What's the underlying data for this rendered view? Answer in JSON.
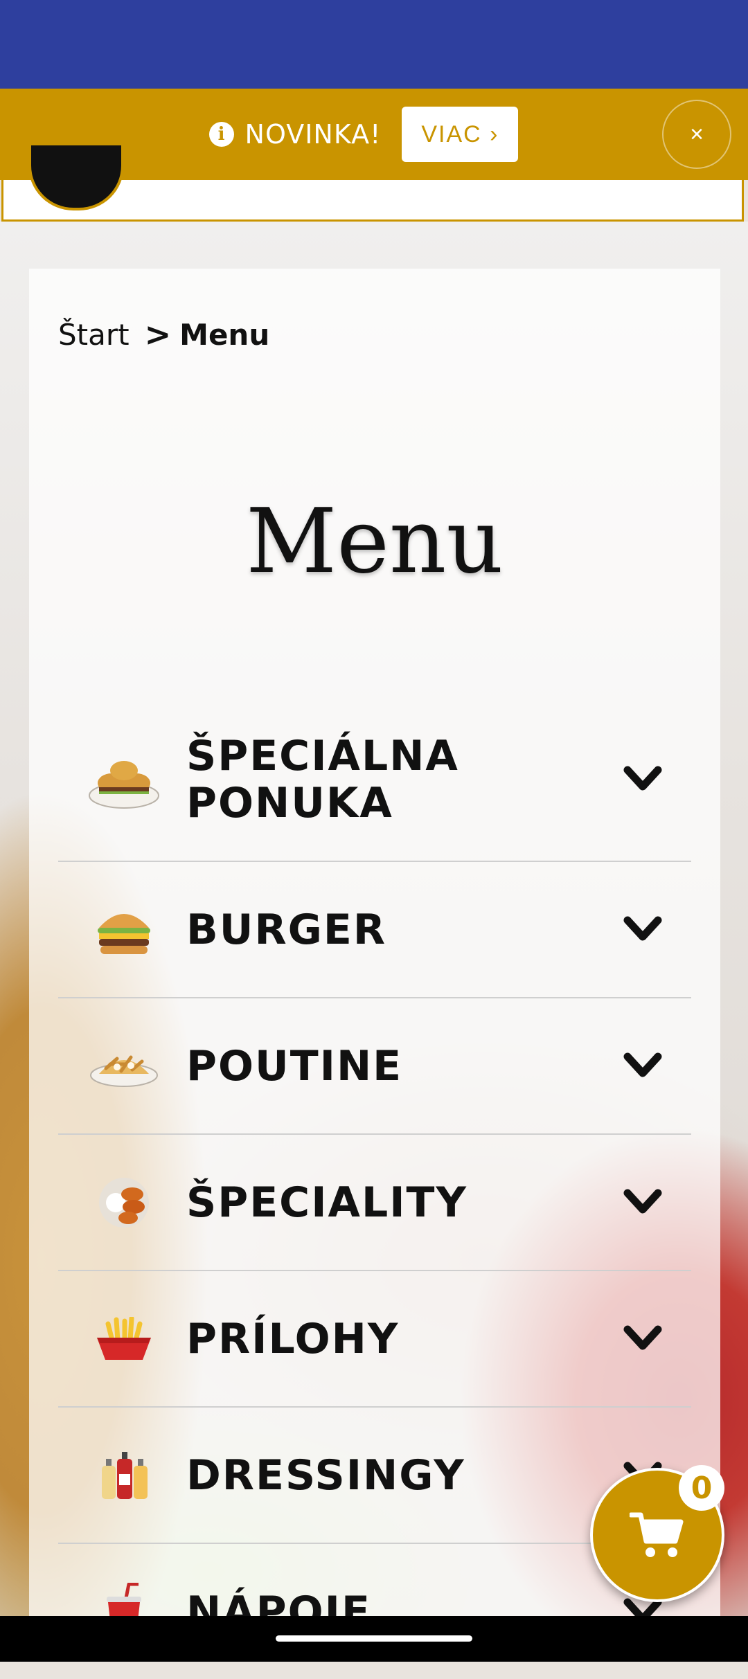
{
  "promo": {
    "text": "NOVINKA!",
    "button_label": "VIAC ›",
    "close_label": "×",
    "info_icon": "info-icon"
  },
  "breadcrumb": {
    "home": "Štart",
    "separator": ">",
    "current": "Menu"
  },
  "page_title": "Menu",
  "categories": [
    {
      "label": "ŠPECIÁLNA PONUKA",
      "icon": "burger-plate-icon"
    },
    {
      "label": "BURGER",
      "icon": "burger-icon"
    },
    {
      "label": "POUTINE",
      "icon": "poutine-icon"
    },
    {
      "label": "ŠPECIALITY",
      "icon": "wings-icon"
    },
    {
      "label": "PRÍLOHY",
      "icon": "fries-icon"
    },
    {
      "label": "DRESSINGY",
      "icon": "sauce-bottles-icon"
    },
    {
      "label": "NÁPOJE",
      "icon": "drink-cup-icon"
    }
  ],
  "cart": {
    "count": "0",
    "icon": "cart-icon"
  },
  "colors": {
    "status_bar": "#2e3f9e",
    "brand_gold": "#c99400",
    "text": "#111111"
  }
}
